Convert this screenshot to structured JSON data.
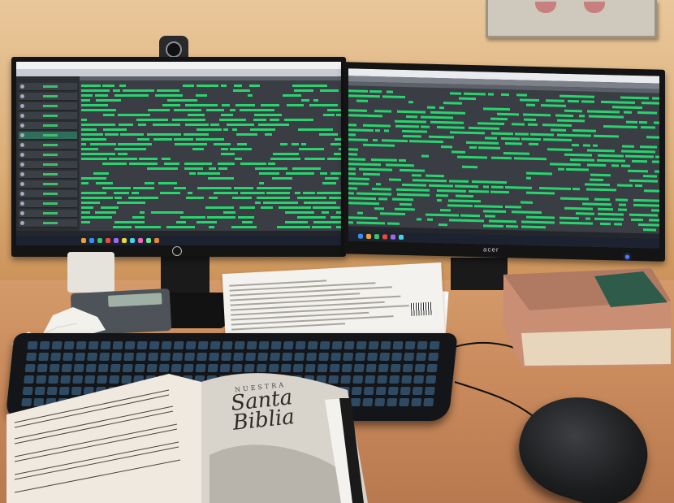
{
  "monitor_left": {
    "brand_logo": "hp"
  },
  "monitor_right": {
    "brand": "acer"
  },
  "book": {
    "publisher_line": "NUESTRA",
    "title_line1": "Santa",
    "title_line2": "Biblia"
  },
  "colors": {
    "daw_track_green": "#28d46e",
    "daw_background": "#3a3e44",
    "wall": "#e2b886",
    "desk": "#c98a5c"
  },
  "icons": {
    "webcam": "webcam-icon",
    "power": "power-led-icon"
  }
}
